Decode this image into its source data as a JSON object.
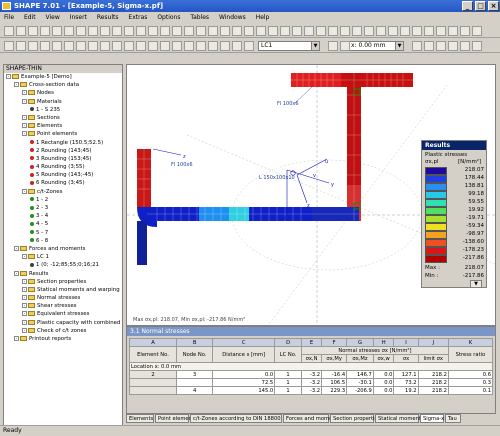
{
  "window": {
    "title": "SHAPE 7.01 - [Example-5, Sigma-x.pf]"
  },
  "menu": [
    "File",
    "Edit",
    "View",
    "Insert",
    "Results",
    "Extras",
    "Options",
    "Tables",
    "Windows",
    "Help"
  ],
  "toolbar": {
    "loadcase": "LC1",
    "location": "x: 0.00 mm"
  },
  "navigator": {
    "root": "SHAPE-THIN",
    "items": [
      {
        "label": "Example-5 [Demo]",
        "level": 1,
        "kind": "root"
      },
      {
        "label": "Cross-section data",
        "level": 2,
        "kind": "folder"
      },
      {
        "label": "Nodes",
        "level": 3,
        "kind": "folder"
      },
      {
        "label": "Materials",
        "level": 3,
        "kind": "folder"
      },
      {
        "label": "1 - S 235",
        "level": 4,
        "kind": "item"
      },
      {
        "label": "Sections",
        "level": 3,
        "kind": "folder"
      },
      {
        "label": "Elements",
        "level": 3,
        "kind": "folder"
      },
      {
        "label": "Point elements",
        "level": 3,
        "kind": "folder"
      },
      {
        "label": "1 Rectangle (150.5;52.5)",
        "level": 4,
        "kind": "point"
      },
      {
        "label": "2 Rounding (143;45)",
        "level": 4,
        "kind": "point"
      },
      {
        "label": "3 Rounding (153;45)",
        "level": 4,
        "kind": "point"
      },
      {
        "label": "4 Rounding (3;55)",
        "level": 4,
        "kind": "point"
      },
      {
        "label": "5 Rounding (143;-45)",
        "level": 4,
        "kind": "point"
      },
      {
        "label": "6 Rounding (3;45)",
        "level": 4,
        "kind": "point"
      },
      {
        "label": "c/t-Zones",
        "level": 3,
        "kind": "folder"
      },
      {
        "label": "1 - 2",
        "level": 4,
        "kind": "zone"
      },
      {
        "label": "2 - 3",
        "level": 4,
        "kind": "zone"
      },
      {
        "label": "3 - 4",
        "level": 4,
        "kind": "zone"
      },
      {
        "label": "4 - 5",
        "level": 4,
        "kind": "zone"
      },
      {
        "label": "5 - 7",
        "level": 4,
        "kind": "zone"
      },
      {
        "label": "6 - 8",
        "level": 4,
        "kind": "zone"
      },
      {
        "label": "Forces and moments",
        "level": 2,
        "kind": "folder"
      },
      {
        "label": "LC 1",
        "level": 3,
        "kind": "folder"
      },
      {
        "label": "1 (0; -12;85;55;0;16;21",
        "level": 4,
        "kind": "item"
      },
      {
        "label": "Results",
        "level": 2,
        "kind": "folder"
      },
      {
        "label": "Section properties",
        "level": 3,
        "kind": "folder"
      },
      {
        "label": "Statical moments and warping",
        "level": 3,
        "kind": "folder"
      },
      {
        "label": "Normal stresses",
        "level": 3,
        "kind": "folder"
      },
      {
        "label": "Shear stresses",
        "level": 3,
        "kind": "folder"
      },
      {
        "label": "Equivalent stresses",
        "level": 3,
        "kind": "folder"
      },
      {
        "label": "Plastic capacity with combined",
        "level": 3,
        "kind": "folder"
      },
      {
        "label": "Check of c/t zones",
        "level": 3,
        "kind": "folder"
      },
      {
        "label": "Printout reports",
        "level": 2,
        "kind": "folder"
      }
    ]
  },
  "canvas": {
    "labels": {
      "fl_top": "Fl 100x6",
      "fl_left": "Fl 100x6",
      "angle": "L 150x100x10",
      "axis_z": "z",
      "axis_u": "u",
      "axis_v": "v",
      "axis_y": "y",
      "axis_zi": "z",
      "axis_z2": "z"
    },
    "footer": "Max σx,pl: 218.07, Min σx,pl: -217.86 N/mm²"
  },
  "results_panel": {
    "title": "Results",
    "subtitle": "Plastic stresses",
    "quantity": "σx,pl",
    "unit": "[N/mm²]",
    "legend": [
      {
        "value": "218.07",
        "color": "#1f0aa0"
      },
      {
        "value": "178.44",
        "color": "#2040e0"
      },
      {
        "value": "138.81",
        "color": "#2890f0"
      },
      {
        "value": "99.18",
        "color": "#28c8e8"
      },
      {
        "value": "59.55",
        "color": "#30e0b0"
      },
      {
        "value": "19.92",
        "color": "#50e060"
      },
      {
        "value": "-19.71",
        "color": "#a8e030"
      },
      {
        "value": "-59.34",
        "color": "#f0e020"
      },
      {
        "value": "-98.97",
        "color": "#f8a020"
      },
      {
        "value": "-138.60",
        "color": "#f05020"
      },
      {
        "value": "-178.23",
        "color": "#d81818"
      },
      {
        "value": "-217.86",
        "color": "#b00000"
      }
    ],
    "max_label": "Max :",
    "max": "218.07",
    "min_label": "Min :",
    "min": "-217.86"
  },
  "table": {
    "title": "3.1 Normal stresses",
    "col_letters": [
      "A",
      "B",
      "C",
      "D",
      "E",
      "F",
      "G",
      "H",
      "I",
      "J",
      "K"
    ],
    "headers": [
      "Element No.",
      "Node No.",
      "Distance s [mm]",
      "LC No.",
      "σx,N",
      "σx,My",
      "σx,Mz",
      "σx,w",
      "σx",
      "limit σx",
      "Stress ratio"
    ],
    "group_header": "Normal stresses σx [N/mm²]",
    "location": "Location x: 0.0 mm",
    "rows": [
      {
        "el": "2",
        "node": "3",
        "dist": "0.0",
        "lc": "1",
        "n": "-3.2",
        "my": "-16.4",
        "mz": "146.7",
        "w": "0.0",
        "s": "127.1",
        "lim": "218.2",
        "ratio": "0.6"
      },
      {
        "el": "",
        "node": "",
        "dist": "72.5",
        "lc": "1",
        "n": "-3.2",
        "my": "106.5",
        "mz": "-30.1",
        "w": "0.0",
        "s": "73.2",
        "lim": "218.2",
        "ratio": "0.3"
      },
      {
        "el": "",
        "node": "4",
        "dist": "145.0",
        "lc": "1",
        "n": "-3.2",
        "my": "229.3",
        "mz": "-206.9",
        "w": "0.0",
        "s": "19.2",
        "lim": "218.2",
        "ratio": "0.1"
      }
    ]
  },
  "tabs": [
    "Elements",
    "Point elements",
    "c/t-Zones according to DIN 18800",
    "Forces and moments",
    "Section properties",
    "Statical moments",
    "Sigma-x",
    "Tau"
  ],
  "status": "Ready"
}
